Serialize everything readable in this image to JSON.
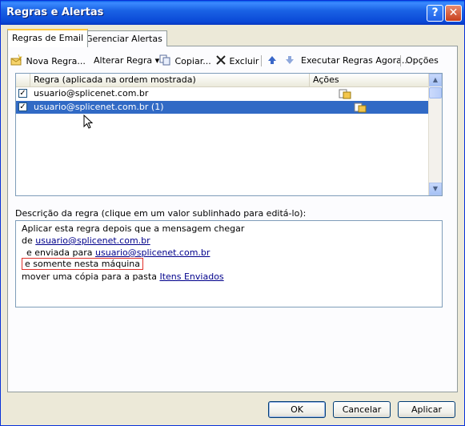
{
  "window": {
    "title": "Regras e Alertas",
    "help_glyph": "?",
    "close_glyph": "✕"
  },
  "tabs": [
    {
      "label": "Regras de Email",
      "active": true
    },
    {
      "label": "Gerenciar Alertas",
      "active": false
    }
  ],
  "toolbar": {
    "new_rule": "Nova Regra...",
    "change_rule": "Alterar Regra",
    "change_rule_arrow": "▾",
    "copy": "Copiar...",
    "delete": "Excluir",
    "run_rules": "Executar Regras Agora...",
    "options": "Opções"
  },
  "rules_table": {
    "columns": [
      "Regra (aplicada na ordem mostrada)",
      "Ações"
    ],
    "rows": [
      {
        "name": "usuario@splicenet.com.br",
        "checked": true,
        "selected": false
      },
      {
        "name": "usuario@splicenet.com.br (1)",
        "checked": true,
        "selected": true
      }
    ]
  },
  "description": {
    "label": "Descrição da regra (clique em um valor sublinhado para editá-lo):",
    "line1": "Aplicar esta regra depois que a mensagem chegar",
    "line2_prefix": "de ",
    "line2_link": "usuario@splicenet.com.br",
    "line3_prefix": "e enviada para ",
    "line3_link": "usuario@splicenet.com.br",
    "line4": "e somente nesta máquina",
    "line5_prefix": "mover uma cópia para a pasta ",
    "line5_link": "Itens Enviados"
  },
  "buttons": {
    "ok": "OK",
    "cancel": "Cancelar",
    "apply": "Aplicar"
  },
  "colors": {
    "title_bar": "#0a5fe8",
    "selection": "#316ac5",
    "link": "#00008b",
    "highlight_box": "#e0302a"
  }
}
